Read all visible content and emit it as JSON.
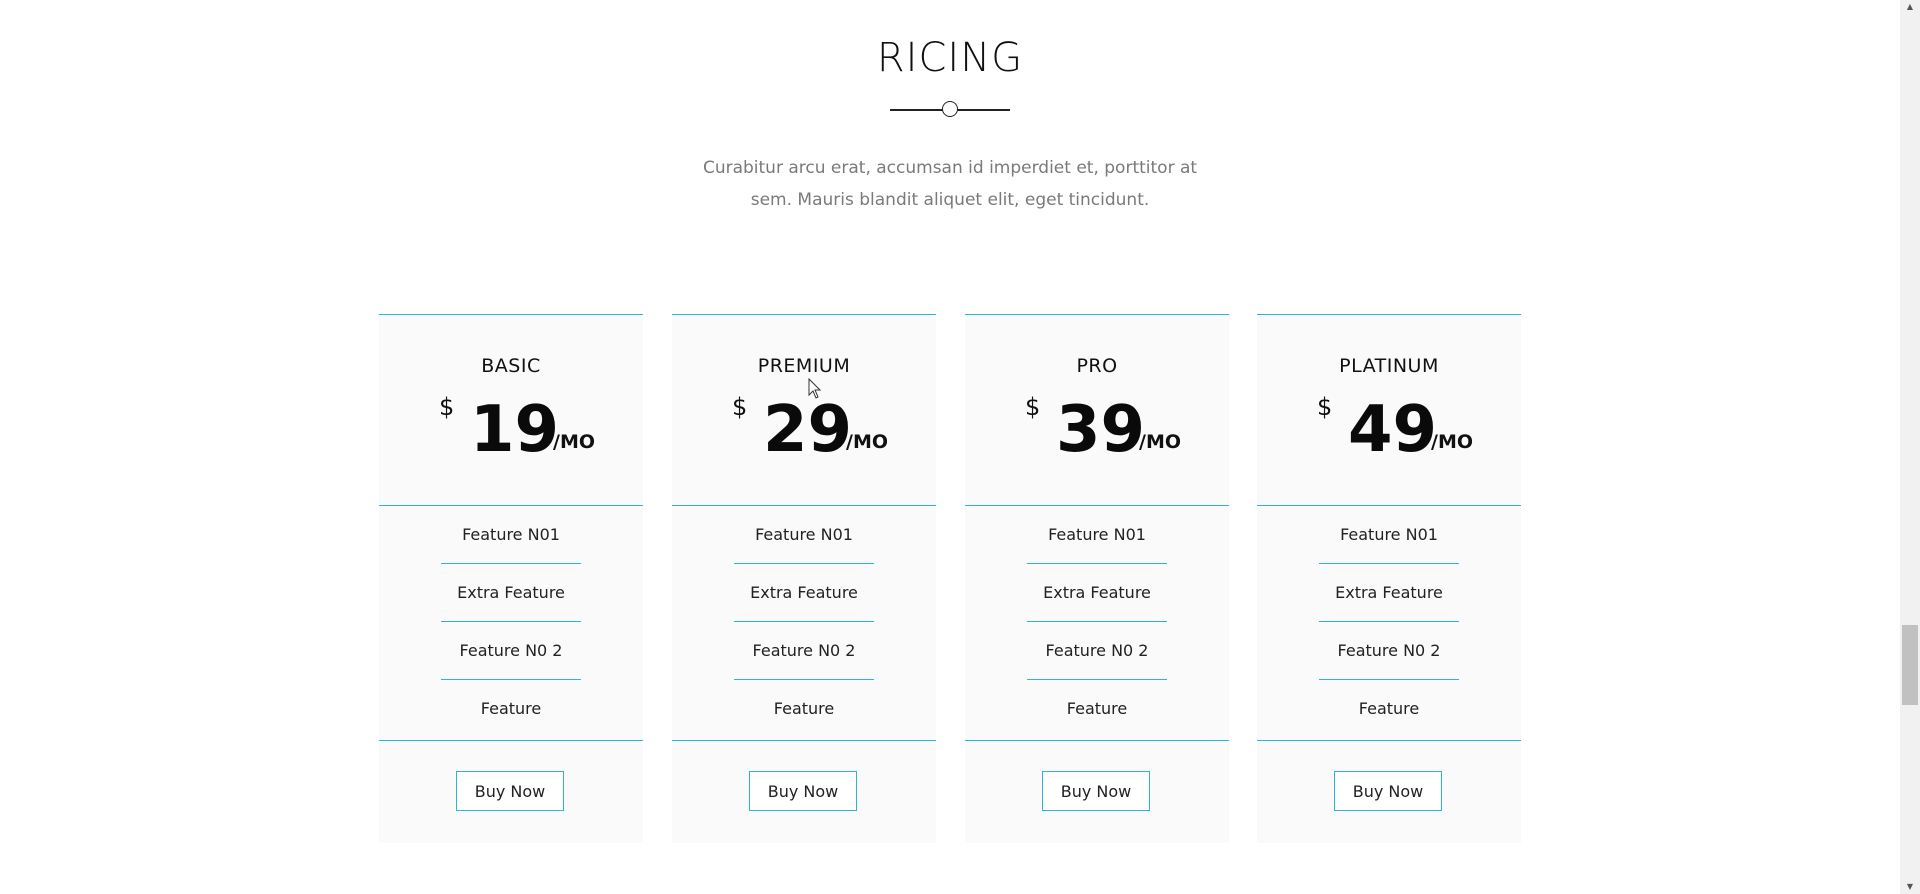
{
  "section": {
    "title": "RICING",
    "description": "Curabitur arcu erat, accumsan id imperdiet et, porttitor at sem. Mauris blandit aliquet elit, eget tincidunt."
  },
  "plans": [
    {
      "name": "BASIC",
      "currency": "$",
      "amount": "19",
      "period": "/MO",
      "features": [
        "Feature N01",
        "Extra Feature",
        "Feature N0 2",
        "Feature"
      ],
      "button": "Buy Now"
    },
    {
      "name": "PREMIUM",
      "currency": "$",
      "amount": "29",
      "period": "/MO",
      "features": [
        "Feature N01",
        "Extra Feature",
        "Feature N0 2",
        "Feature"
      ],
      "button": "Buy Now"
    },
    {
      "name": "PRO",
      "currency": "$",
      "amount": "39",
      "period": "/MO",
      "features": [
        "Feature N01",
        "Extra Feature",
        "Feature N0 2",
        "Feature"
      ],
      "button": "Buy Now"
    },
    {
      "name": "PLATINUM",
      "currency": "$",
      "amount": "49",
      "period": "/MO",
      "features": [
        "Feature N01",
        "Extra Feature",
        "Feature N0 2",
        "Feature"
      ],
      "button": "Buy Now"
    }
  ],
  "colors": {
    "accent": "#29b6d8",
    "card_background": "#fafafa",
    "description_text": "#7a7a7a"
  },
  "icons": {
    "divider": "line-circle-divider-icon",
    "cursor": "mouse-pointer-icon",
    "scroll_up": "scroll-up-arrow-icon",
    "scroll_down": "scroll-down-arrow-icon"
  }
}
